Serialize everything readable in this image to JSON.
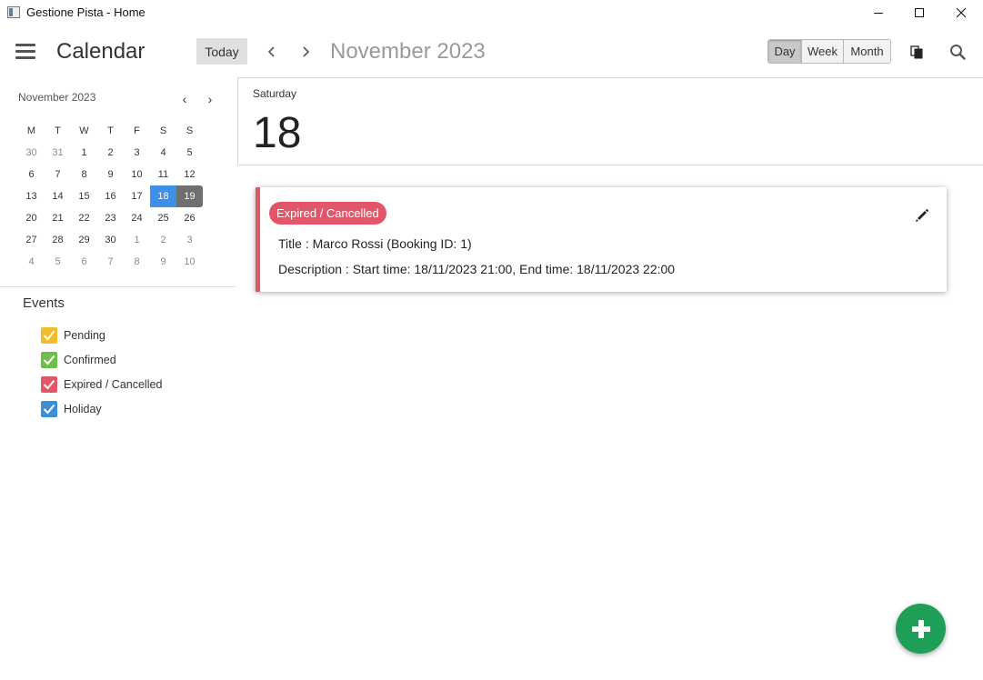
{
  "window": {
    "title": "Gestione Pista - Home"
  },
  "toolbar": {
    "app_title": "Calendar",
    "today_label": "Today",
    "current_period": "November 2023",
    "views": [
      {
        "label": "Day",
        "active": true
      },
      {
        "label": "Week",
        "active": false
      },
      {
        "label": "Month",
        "active": false
      }
    ]
  },
  "mini_calendar": {
    "month_label": "November 2023",
    "prev_symbol": "‹",
    "next_symbol": "›",
    "weekday_headers": [
      "M",
      "T",
      "W",
      "T",
      "F",
      "S",
      "S"
    ],
    "weeks": [
      [
        "30",
        "31",
        "1",
        "2",
        "3",
        "4",
        "5"
      ],
      [
        "6",
        "7",
        "8",
        "9",
        "10",
        "11",
        "12"
      ],
      [
        "13",
        "14",
        "15",
        "16",
        "17",
        "18",
        "19"
      ],
      [
        "20",
        "21",
        "22",
        "23",
        "24",
        "25",
        "26"
      ],
      [
        "27",
        "28",
        "29",
        "30",
        "1",
        "2",
        "3"
      ],
      [
        "4",
        "5",
        "6",
        "7",
        "8",
        "9",
        "10"
      ]
    ],
    "selected_day": "18",
    "today_day": "19"
  },
  "events_filter": {
    "title": "Events",
    "items": [
      {
        "label": "Pending",
        "color": "#f2bd2b",
        "checked": true
      },
      {
        "label": "Confirmed",
        "color": "#6cc04a",
        "checked": true
      },
      {
        "label": "Expired / Cancelled",
        "color": "#e2566a",
        "checked": true
      },
      {
        "label": "Holiday",
        "color": "#3a8fd6",
        "checked": true
      }
    ]
  },
  "day_view": {
    "weekday": "Saturday",
    "day_number": "18"
  },
  "event_card": {
    "status_label": "Expired / Cancelled",
    "status_color": "#e2566a",
    "title_line": "Title : Marco Rossi (Booking ID: 1)",
    "description_line": "Description : Start time: 18/11/2023 21:00, End time: 18/11/2023 22:00"
  },
  "fab": {
    "icon": "plus-icon",
    "color": "#1f9e58"
  },
  "icons": {
    "menu": "hamburger-icon",
    "prev": "chevron-left-icon",
    "next": "chevron-right-icon",
    "copy": "copy-icon",
    "search": "search-icon",
    "edit": "pencil-icon"
  }
}
